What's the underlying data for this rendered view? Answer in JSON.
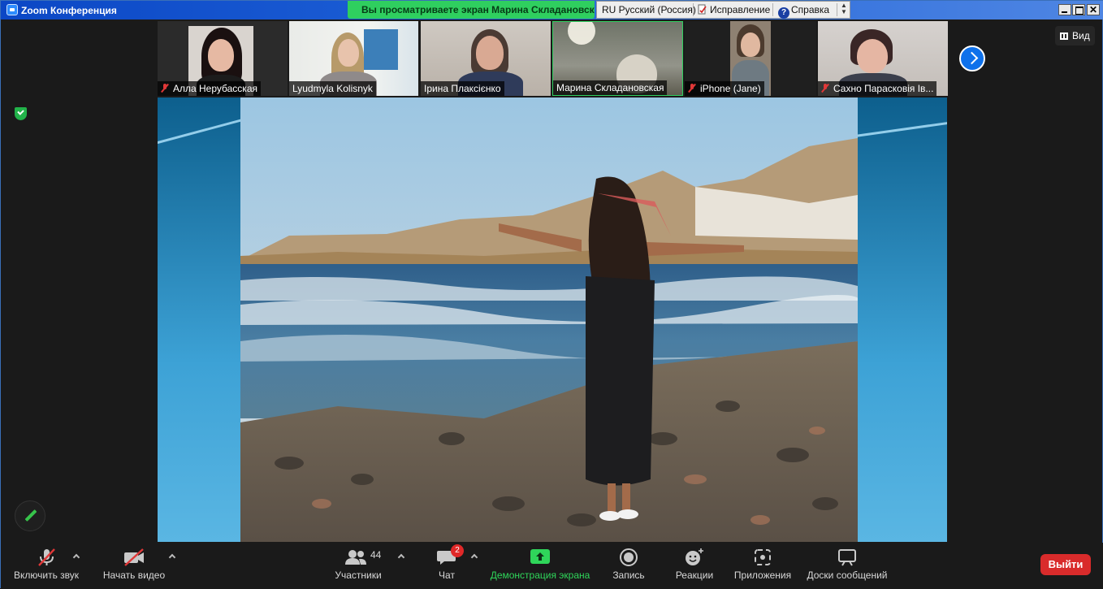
{
  "window": {
    "title": "Zoom Конференция",
    "share_banner": "Вы просматриваете экран Марина Складановская",
    "language_bar": {
      "language": "RU Русский (Россия)",
      "correction": "Исправление",
      "help": "Справка"
    }
  },
  "gallery": {
    "participants": [
      {
        "name": "Алла Нерубасская",
        "muted": true
      },
      {
        "name": "Lyudmyla Kolisnyk",
        "muted": false
      },
      {
        "name": "Ірина Плаксієнко",
        "muted": false
      },
      {
        "name": "Марина Складановская",
        "muted": false,
        "active_speaker": true
      },
      {
        "name": "iPhone (Jane)",
        "muted": true
      },
      {
        "name": "Сахно Парасковія Ів...",
        "muted": true
      }
    ],
    "view_label": "Вид",
    "next_page_icon": "chevron-right-icon"
  },
  "toolbar": {
    "unmute_label": "Включить звук",
    "start_video_label": "Начать видео",
    "participants_label": "Участники",
    "participants_count": "44",
    "chat_label": "Чат",
    "chat_unread": "2",
    "share_screen_label": "Демонстрация экрана",
    "record_label": "Запись",
    "reactions_label": "Реакции",
    "apps_label": "Приложения",
    "whiteboards_label": "Доски сообщений",
    "leave_label": "Выйти"
  },
  "colors": {
    "share_green": "#2fcf5f",
    "leave_red": "#d92b2b",
    "accent_blue": "#0e71eb"
  }
}
